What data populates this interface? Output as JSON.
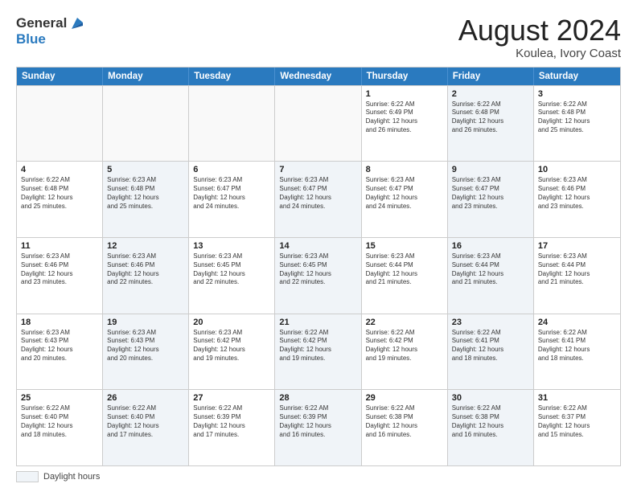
{
  "header": {
    "logo_general": "General",
    "logo_blue": "Blue",
    "title": "August 2024",
    "location": "Koulea, Ivory Coast"
  },
  "days_of_week": [
    "Sunday",
    "Monday",
    "Tuesday",
    "Wednesday",
    "Thursday",
    "Friday",
    "Saturday"
  ],
  "weeks": [
    [
      {
        "day": "",
        "info": "",
        "shaded": false,
        "empty": true
      },
      {
        "day": "",
        "info": "",
        "shaded": false,
        "empty": true
      },
      {
        "day": "",
        "info": "",
        "shaded": false,
        "empty": true
      },
      {
        "day": "",
        "info": "",
        "shaded": false,
        "empty": true
      },
      {
        "day": "1",
        "info": "Sunrise: 6:22 AM\nSunset: 6:49 PM\nDaylight: 12 hours\nand 26 minutes.",
        "shaded": false,
        "empty": false
      },
      {
        "day": "2",
        "info": "Sunrise: 6:22 AM\nSunset: 6:48 PM\nDaylight: 12 hours\nand 26 minutes.",
        "shaded": true,
        "empty": false
      },
      {
        "day": "3",
        "info": "Sunrise: 6:22 AM\nSunset: 6:48 PM\nDaylight: 12 hours\nand 25 minutes.",
        "shaded": false,
        "empty": false
      }
    ],
    [
      {
        "day": "4",
        "info": "Sunrise: 6:22 AM\nSunset: 6:48 PM\nDaylight: 12 hours\nand 25 minutes.",
        "shaded": false,
        "empty": false
      },
      {
        "day": "5",
        "info": "Sunrise: 6:23 AM\nSunset: 6:48 PM\nDaylight: 12 hours\nand 25 minutes.",
        "shaded": true,
        "empty": false
      },
      {
        "day": "6",
        "info": "Sunrise: 6:23 AM\nSunset: 6:47 PM\nDaylight: 12 hours\nand 24 minutes.",
        "shaded": false,
        "empty": false
      },
      {
        "day": "7",
        "info": "Sunrise: 6:23 AM\nSunset: 6:47 PM\nDaylight: 12 hours\nand 24 minutes.",
        "shaded": true,
        "empty": false
      },
      {
        "day": "8",
        "info": "Sunrise: 6:23 AM\nSunset: 6:47 PM\nDaylight: 12 hours\nand 24 minutes.",
        "shaded": false,
        "empty": false
      },
      {
        "day": "9",
        "info": "Sunrise: 6:23 AM\nSunset: 6:47 PM\nDaylight: 12 hours\nand 23 minutes.",
        "shaded": true,
        "empty": false
      },
      {
        "day": "10",
        "info": "Sunrise: 6:23 AM\nSunset: 6:46 PM\nDaylight: 12 hours\nand 23 minutes.",
        "shaded": false,
        "empty": false
      }
    ],
    [
      {
        "day": "11",
        "info": "Sunrise: 6:23 AM\nSunset: 6:46 PM\nDaylight: 12 hours\nand 23 minutes.",
        "shaded": false,
        "empty": false
      },
      {
        "day": "12",
        "info": "Sunrise: 6:23 AM\nSunset: 6:46 PM\nDaylight: 12 hours\nand 22 minutes.",
        "shaded": true,
        "empty": false
      },
      {
        "day": "13",
        "info": "Sunrise: 6:23 AM\nSunset: 6:45 PM\nDaylight: 12 hours\nand 22 minutes.",
        "shaded": false,
        "empty": false
      },
      {
        "day": "14",
        "info": "Sunrise: 6:23 AM\nSunset: 6:45 PM\nDaylight: 12 hours\nand 22 minutes.",
        "shaded": true,
        "empty": false
      },
      {
        "day": "15",
        "info": "Sunrise: 6:23 AM\nSunset: 6:44 PM\nDaylight: 12 hours\nand 21 minutes.",
        "shaded": false,
        "empty": false
      },
      {
        "day": "16",
        "info": "Sunrise: 6:23 AM\nSunset: 6:44 PM\nDaylight: 12 hours\nand 21 minutes.",
        "shaded": true,
        "empty": false
      },
      {
        "day": "17",
        "info": "Sunrise: 6:23 AM\nSunset: 6:44 PM\nDaylight: 12 hours\nand 21 minutes.",
        "shaded": false,
        "empty": false
      }
    ],
    [
      {
        "day": "18",
        "info": "Sunrise: 6:23 AM\nSunset: 6:43 PM\nDaylight: 12 hours\nand 20 minutes.",
        "shaded": false,
        "empty": false
      },
      {
        "day": "19",
        "info": "Sunrise: 6:23 AM\nSunset: 6:43 PM\nDaylight: 12 hours\nand 20 minutes.",
        "shaded": true,
        "empty": false
      },
      {
        "day": "20",
        "info": "Sunrise: 6:23 AM\nSunset: 6:42 PM\nDaylight: 12 hours\nand 19 minutes.",
        "shaded": false,
        "empty": false
      },
      {
        "day": "21",
        "info": "Sunrise: 6:22 AM\nSunset: 6:42 PM\nDaylight: 12 hours\nand 19 minutes.",
        "shaded": true,
        "empty": false
      },
      {
        "day": "22",
        "info": "Sunrise: 6:22 AM\nSunset: 6:42 PM\nDaylight: 12 hours\nand 19 minutes.",
        "shaded": false,
        "empty": false
      },
      {
        "day": "23",
        "info": "Sunrise: 6:22 AM\nSunset: 6:41 PM\nDaylight: 12 hours\nand 18 minutes.",
        "shaded": true,
        "empty": false
      },
      {
        "day": "24",
        "info": "Sunrise: 6:22 AM\nSunset: 6:41 PM\nDaylight: 12 hours\nand 18 minutes.",
        "shaded": false,
        "empty": false
      }
    ],
    [
      {
        "day": "25",
        "info": "Sunrise: 6:22 AM\nSunset: 6:40 PM\nDaylight: 12 hours\nand 18 minutes.",
        "shaded": false,
        "empty": false
      },
      {
        "day": "26",
        "info": "Sunrise: 6:22 AM\nSunset: 6:40 PM\nDaylight: 12 hours\nand 17 minutes.",
        "shaded": true,
        "empty": false
      },
      {
        "day": "27",
        "info": "Sunrise: 6:22 AM\nSunset: 6:39 PM\nDaylight: 12 hours\nand 17 minutes.",
        "shaded": false,
        "empty": false
      },
      {
        "day": "28",
        "info": "Sunrise: 6:22 AM\nSunset: 6:39 PM\nDaylight: 12 hours\nand 16 minutes.",
        "shaded": true,
        "empty": false
      },
      {
        "day": "29",
        "info": "Sunrise: 6:22 AM\nSunset: 6:38 PM\nDaylight: 12 hours\nand 16 minutes.",
        "shaded": false,
        "empty": false
      },
      {
        "day": "30",
        "info": "Sunrise: 6:22 AM\nSunset: 6:38 PM\nDaylight: 12 hours\nand 16 minutes.",
        "shaded": true,
        "empty": false
      },
      {
        "day": "31",
        "info": "Sunrise: 6:22 AM\nSunset: 6:37 PM\nDaylight: 12 hours\nand 15 minutes.",
        "shaded": false,
        "empty": false
      }
    ]
  ],
  "footer": {
    "daylight_label": "Daylight hours"
  }
}
